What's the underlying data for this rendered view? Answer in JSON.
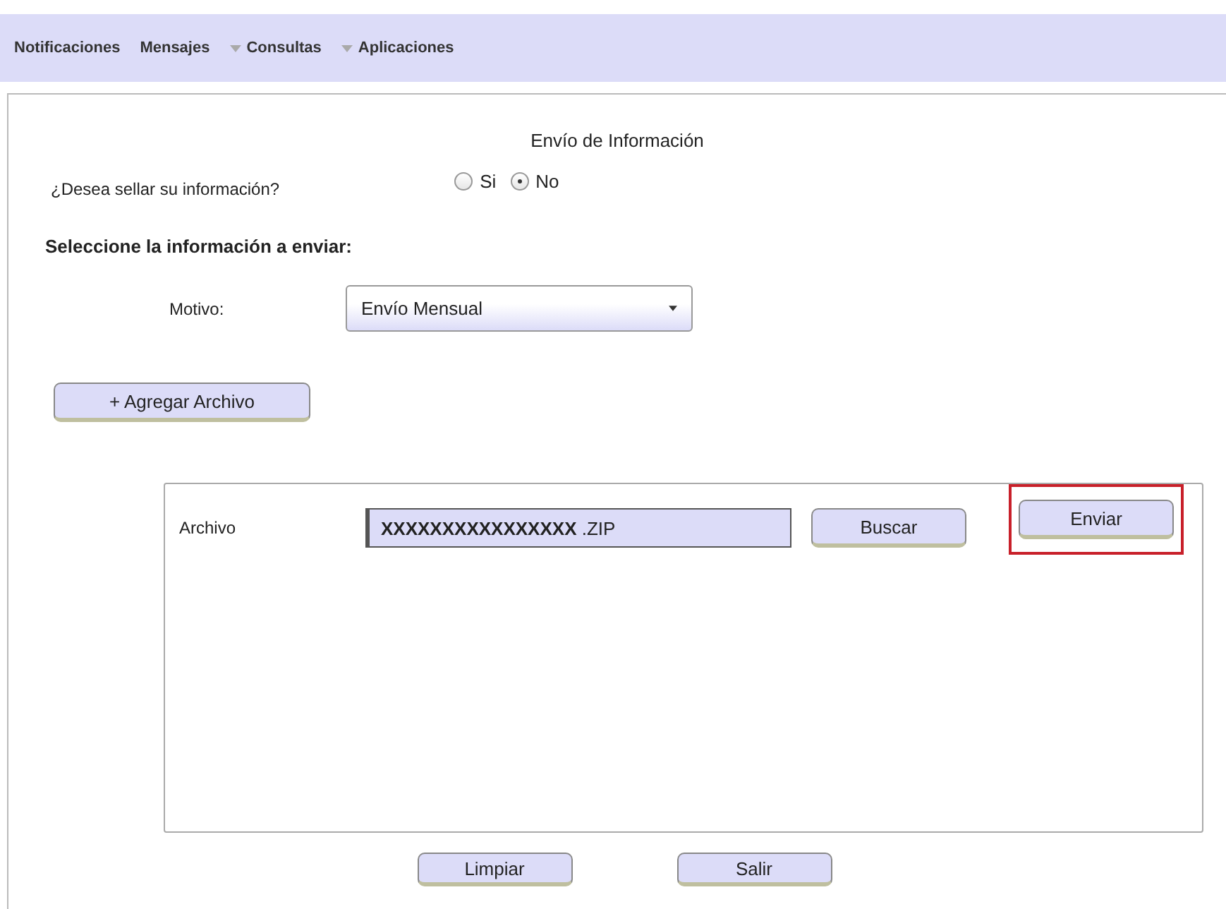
{
  "menu": [
    {
      "label": "Notificaciones",
      "has_dropdown": false
    },
    {
      "label": "Mensajes",
      "has_dropdown": false
    },
    {
      "label": "Consultas",
      "has_dropdown": true
    },
    {
      "label": "Aplicaciones",
      "has_dropdown": true
    }
  ],
  "form": {
    "title": "Envío de Información",
    "seal_question": "¿Desea sellar su información?",
    "seal_options": [
      {
        "label": "Si",
        "selected": false
      },
      {
        "label": "No",
        "selected": true
      }
    ],
    "section_heading": "Seleccione la información a enviar:",
    "reason_label": "Motivo:",
    "reason_value": "Envío Mensual",
    "add_file_button": "+ Agregar Archivo",
    "file_panel": {
      "label": "Archivo",
      "value": "**XXXXXXXXXXXXXXXX** .ZIP",
      "browse_button": "Buscar",
      "send_button": {
        "label": "Enviar",
        "highlighted": true
      }
    },
    "buttons": [
      "Limpiar",
      "Salir"
    ]
  }
}
